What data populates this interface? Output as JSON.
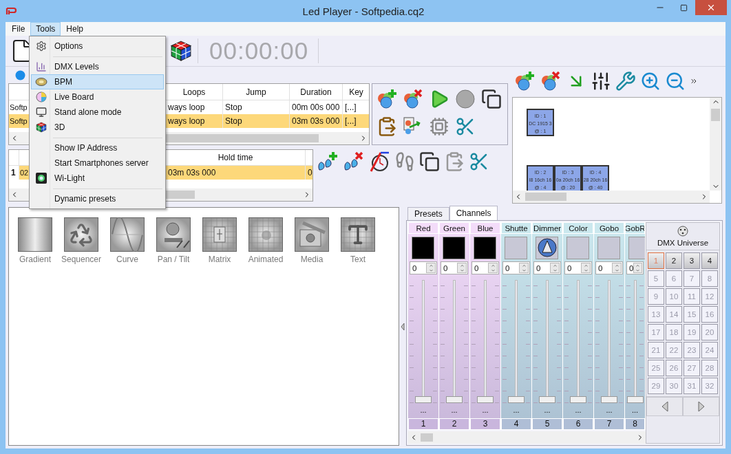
{
  "window": {
    "title": "Led Player - Softpedia.cq2"
  },
  "menu_bar": [
    {
      "label": "File",
      "selected": false
    },
    {
      "label": "Tools",
      "selected": true
    },
    {
      "label": "Help",
      "selected": false
    }
  ],
  "tools_menu": [
    {
      "kind": "item",
      "label": "Options",
      "selected": false
    },
    {
      "kind": "separator"
    },
    {
      "kind": "item",
      "label": "DMX Levels",
      "selected": false
    },
    {
      "kind": "item",
      "label": "BPM",
      "selected": true
    },
    {
      "kind": "item",
      "label": "Live Board",
      "selected": false
    },
    {
      "kind": "item",
      "label": "Stand alone mode",
      "selected": false
    },
    {
      "kind": "item",
      "label": "3D",
      "selected": false
    },
    {
      "kind": "separator"
    },
    {
      "kind": "item",
      "label": "Show IP Address",
      "selected": false
    },
    {
      "kind": "item",
      "label": "Start Smartphones server",
      "selected": false
    },
    {
      "kind": "item",
      "label": "Wi-Light",
      "selected": false
    },
    {
      "kind": "separator"
    },
    {
      "kind": "item",
      "label": "Dynamic presets",
      "selected": false
    }
  ],
  "toolbar": {
    "timer": "00:00:00"
  },
  "sequences": {
    "columns": [
      "Loops",
      "Jump",
      "Duration",
      "Key"
    ],
    "rows": [
      {
        "name": "Softp",
        "loops": "ways loop",
        "jump": "Stop",
        "duration": "00m 00s 000",
        "key": "[...]",
        "selected": false
      },
      {
        "name": "Softp",
        "loops": "ways loop",
        "jump": "Stop",
        "duration": "03m 03s 000",
        "key": "[...]",
        "selected": true
      }
    ]
  },
  "steps": {
    "columns": [
      "Hold time"
    ],
    "rows": [
      {
        "index": "1",
        "name": "02",
        "hold_time": "03m 03s 000",
        "column_3": "0",
        "selected": true
      }
    ]
  },
  "fixtures": [
    {
      "id": "ID : 1",
      "model": "DC 1915 3",
      "address": "@ : 1"
    },
    {
      "id": "ID : 2",
      "model": "I8 16ch 16",
      "address": "@ : 4"
    },
    {
      "id": "ID : 3",
      "model": "0a 20ch 16",
      "address": "@ : 20"
    },
    {
      "id": "ID : 4",
      "model": "28 20ch 16",
      "address": "@ : 40"
    }
  ],
  "effects": [
    {
      "label": "Gradient"
    },
    {
      "label": "Sequencer"
    },
    {
      "label": "Curve"
    },
    {
      "label": "Pan / Tilt"
    },
    {
      "label": "Matrix"
    },
    {
      "label": "Animated"
    },
    {
      "label": "Media"
    },
    {
      "label": "Text"
    }
  ],
  "channel_tabs": [
    {
      "label": "Presets",
      "selected": false
    },
    {
      "label": "Channels",
      "selected": true
    }
  ],
  "channels": [
    {
      "name": "Red",
      "kind": "rgb",
      "color": "#f3dcf9",
      "value": "0",
      "level": 0,
      "more": "...",
      "number": "1"
    },
    {
      "name": "Green",
      "kind": "rgb",
      "color": "#f3dcf9",
      "value": "0",
      "level": 0,
      "more": "...",
      "number": "2"
    },
    {
      "name": "Blue",
      "kind": "rgb",
      "color": "#f3dcf9",
      "value": "0",
      "level": 0,
      "more": "...",
      "number": "3"
    },
    {
      "name": "Shutte",
      "kind": "plain",
      "color": "#cbe8ee",
      "value": "0",
      "level": 0,
      "more": "...",
      "number": "4"
    },
    {
      "name": "Dimmer",
      "kind": "dimmer",
      "color": "#cbe8ee",
      "value": "0",
      "level": 0,
      "more": "...",
      "number": "5"
    },
    {
      "name": "Color",
      "kind": "plain",
      "color": "#cbe8ee",
      "value": "0",
      "level": 0,
      "more": "...",
      "number": "6"
    },
    {
      "name": "Gobo",
      "kind": "plain",
      "color": "#cbe8ee",
      "value": "0",
      "level": 0,
      "more": "...",
      "number": "7"
    },
    {
      "name": "GobR",
      "kind": "plain",
      "color": "#cbe8ee",
      "value": "0",
      "level": 0,
      "more": "...",
      "number": "8"
    }
  ],
  "dmx_universe": {
    "title": "DMX Universe",
    "buttons": [
      {
        "label": "1",
        "selected": true,
        "used": true
      },
      {
        "label": "2",
        "selected": false,
        "used": true
      },
      {
        "label": "3",
        "selected": false,
        "used": true
      },
      {
        "label": "4",
        "selected": false,
        "used": true
      },
      {
        "label": "5",
        "selected": false,
        "used": false
      },
      {
        "label": "6",
        "selected": false,
        "used": false
      },
      {
        "label": "7",
        "selected": false,
        "used": false
      },
      {
        "label": "8",
        "selected": false,
        "used": false
      },
      {
        "label": "9",
        "selected": false,
        "used": false
      },
      {
        "label": "10",
        "selected": false,
        "used": false
      },
      {
        "label": "11",
        "selected": false,
        "used": false
      },
      {
        "label": "12",
        "selected": false,
        "used": false
      },
      {
        "label": "13",
        "selected": false,
        "used": false
      },
      {
        "label": "14",
        "selected": false,
        "used": false
      },
      {
        "label": "15",
        "selected": false,
        "used": false
      },
      {
        "label": "16",
        "selected": false,
        "used": false
      },
      {
        "label": "17",
        "selected": false,
        "used": false
      },
      {
        "label": "18",
        "selected": false,
        "used": false
      },
      {
        "label": "19",
        "selected": false,
        "used": false
      },
      {
        "label": "20",
        "selected": false,
        "used": false
      },
      {
        "label": "21",
        "selected": false,
        "used": false
      },
      {
        "label": "22",
        "selected": false,
        "used": false
      },
      {
        "label": "23",
        "selected": false,
        "used": false
      },
      {
        "label": "24",
        "selected": false,
        "used": false
      },
      {
        "label": "25",
        "selected": false,
        "used": false
      },
      {
        "label": "26",
        "selected": false,
        "used": false
      },
      {
        "label": "27",
        "selected": false,
        "used": false
      },
      {
        "label": "28",
        "selected": false,
        "used": false
      },
      {
        "label": "29",
        "selected": false,
        "used": false
      },
      {
        "label": "30",
        "selected": false,
        "used": false
      },
      {
        "label": "31",
        "selected": false,
        "used": false
      },
      {
        "label": "32",
        "selected": false,
        "used": false
      }
    ]
  }
}
